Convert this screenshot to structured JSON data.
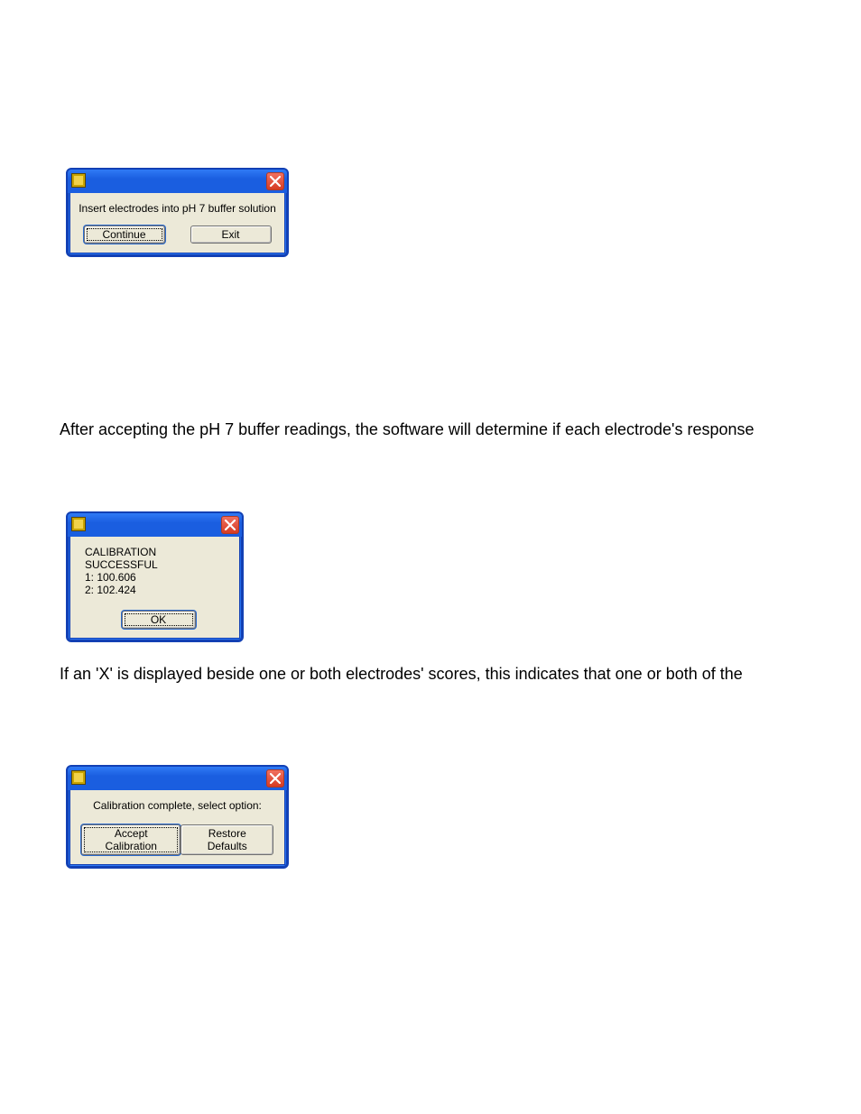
{
  "dialog1": {
    "message": "Insert electrodes into pH 7 buffer solution",
    "continue": "Continue",
    "exit": "Exit"
  },
  "para1": "After accepting the pH 7 buffer readings, the software will determine if each electrode's response",
  "dialog2": {
    "line1": "CALIBRATION SUCCESSFUL",
    "line2": "1: 100.606",
    "line3": "2: 102.424",
    "ok": "OK"
  },
  "para2": "If an 'X' is displayed beside one or both electrodes' scores, this indicates that one or both of the",
  "dialog3": {
    "message": "Calibration complete, select option:",
    "accept": "Accept Calibration",
    "restore": "Restore Defaults"
  }
}
